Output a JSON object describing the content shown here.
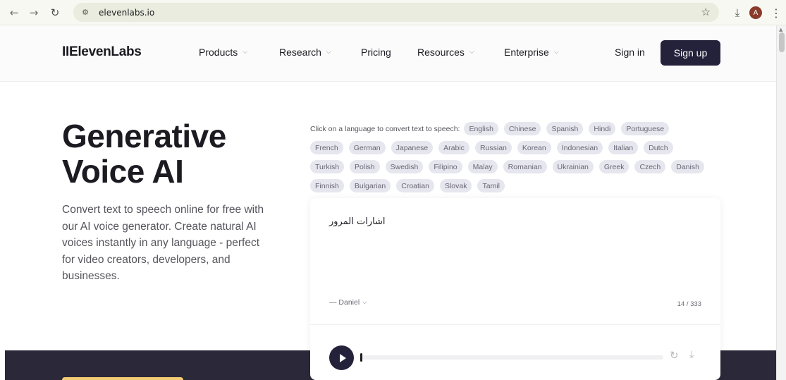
{
  "browser": {
    "url": "elevenlabs.io",
    "avatar_letter": "A",
    "icons": {
      "back": "arrow-left-icon",
      "forward": "arrow-right-icon",
      "reload": "reload-icon",
      "site_info": "tune-icon",
      "bookmark": "star-icon",
      "download": "download-icon",
      "menu": "kebab-menu-icon"
    }
  },
  "header": {
    "logo": "IIElevenLabs",
    "nav": [
      {
        "label": "Products",
        "has_dropdown": true
      },
      {
        "label": "Research",
        "has_dropdown": true
      },
      {
        "label": "Pricing",
        "has_dropdown": false
      },
      {
        "label": "Resources",
        "has_dropdown": true
      },
      {
        "label": "Enterprise",
        "has_dropdown": true
      }
    ],
    "signin": "Sign in",
    "signup": "Sign up"
  },
  "hero": {
    "title_line1": "Generative",
    "title_line2": "Voice AI",
    "subtitle": "Convert text to speech online for free with our AI voice generator. Create natural AI voices instantly in any language - perfect for video creators, developers, and businesses."
  },
  "languages": {
    "intro": "Click on a language to convert text to speech:",
    "rows": [
      [
        "English",
        "Chinese",
        "Spanish",
        "Hindi",
        "Portuguese"
      ],
      [
        "French",
        "German",
        "Japanese",
        "Arabic",
        "Russian",
        "Korean",
        "Indonesian",
        "Italian",
        "Dutch"
      ],
      [
        "Turkish",
        "Polish",
        "Swedish",
        "Filipino",
        "Malay",
        "Romanian",
        "Ukrainian",
        "Greek",
        "Czech",
        "Danish"
      ],
      [
        "Finnish",
        "Bulgarian",
        "Croatian",
        "Slovak",
        "Tamil"
      ]
    ]
  },
  "tts_card": {
    "text": "اشارات المرور",
    "voice": "Daniel",
    "counter": "14 / 333",
    "progress": 0
  },
  "colors": {
    "accent_dark": "#24213a",
    "chip_bg": "#e6e6ee",
    "band": "#2b2939",
    "band_button": "#f4cc75"
  }
}
